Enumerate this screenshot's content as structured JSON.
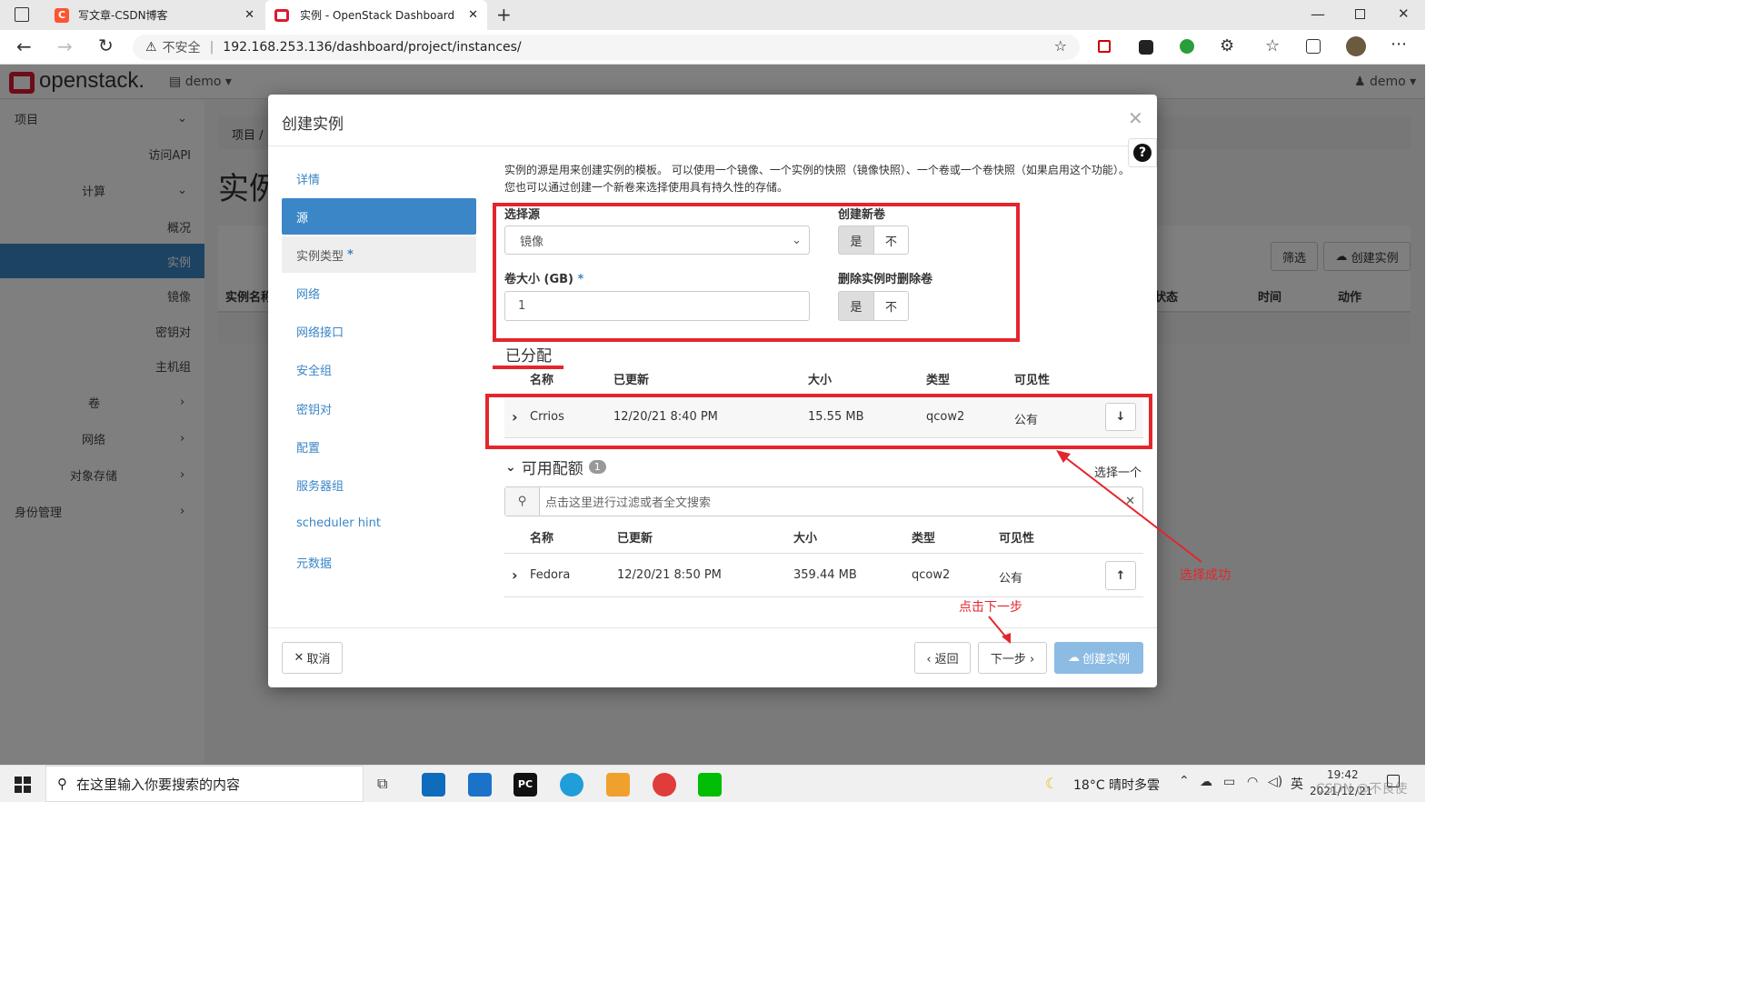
{
  "browser": {
    "tabs": [
      {
        "title": "写文章-CSDN博客"
      },
      {
        "title": "实例 - OpenStack Dashboard"
      }
    ],
    "security": "不安全",
    "url": "192.168.253.136/dashboard/project/instances/"
  },
  "app": {
    "logo": "openstack.",
    "project": "demo",
    "user": "demo",
    "breadcrumb": "项目 /",
    "page_title": "实例",
    "sidebar": {
      "project": "项目",
      "api": "访问API",
      "compute": "计算",
      "overview": "概况",
      "instances": "实例",
      "images": "镜像",
      "keypairs": "密钥对",
      "host_groups": "主机组",
      "volumes": "卷",
      "network": "网络",
      "object_store": "对象存储",
      "identity": "身份管理"
    },
    "toolbar": {
      "filter": "筛选",
      "create": "创建实例"
    },
    "table_headers": {
      "name": "实例名称",
      "status": "状态",
      "time": "时间",
      "action": "动作"
    }
  },
  "modal": {
    "title": "创建实例",
    "steps": [
      "详情",
      "源",
      "实例类型",
      "网络",
      "网络接口",
      "安全组",
      "密钥对",
      "配置",
      "服务器组",
      "scheduler hint",
      "元数据"
    ],
    "required_mark": "*",
    "description": "实例的源是用来创建实例的模板。 可以使用一个镜像、一个实例的快照（镜像快照）、一个卷或一个卷快照（如果启用这个功能）。您也可以通过创建一个新卷来选择使用具有持久性的存储。",
    "select_source_label": "选择源",
    "select_source_value": "镜像",
    "create_volume_label": "创建新卷",
    "yes": "是",
    "no": "不",
    "volume_size_label": "卷大小 (GB)",
    "volume_size_value": "1",
    "delete_volume_label": "删除实例时删除卷",
    "allocated_title": "已分配",
    "columns": {
      "name": "名称",
      "updated": "已更新",
      "size": "大小",
      "type": "类型",
      "visibility": "可见性"
    },
    "allocated_row": {
      "name": "Crrios",
      "updated": "12/20/21 8:40 PM",
      "size": "15.55 MB",
      "type": "qcow2",
      "visibility": "公有"
    },
    "available_title": "可用配额",
    "available_count": "1",
    "search_placeholder": "点击这里进行过滤或者全文搜索",
    "available_row": {
      "name": "Fedora",
      "updated": "12/20/21 8:50 PM",
      "size": "359.44 MB",
      "type": "qcow2",
      "visibility": "公有"
    },
    "cancel": "取消",
    "back": "‹ 返回",
    "next": "下一步 ›",
    "create": "创建实例"
  },
  "annotations": {
    "select_one": "选择一个",
    "select_success": "选择成功",
    "click_next": "点击下一步"
  },
  "taskbar": {
    "search": "在这里输入你要搜索的内容",
    "weather": "18°C  晴时多雲",
    "ime": "英",
    "time": "19:42",
    "date": "2021/12/21",
    "watermark": "CSDN @不良使"
  },
  "colors": {
    "accent": "#3a86c6",
    "annotation": "#e3262c",
    "openstack_red": "#da1a32"
  }
}
